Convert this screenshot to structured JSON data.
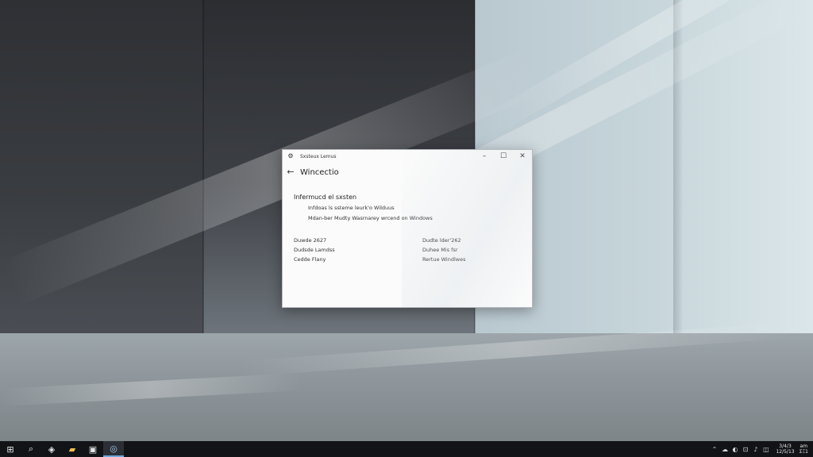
{
  "window": {
    "title": "Sxsteux Lemus",
    "page_title": "Wincectio",
    "section_heading": "Infermucd el sxsten",
    "details": [
      "Infdoas ls ssteme leurk'o Wilduus",
      "Mdan-ber Mudty Wasrnarey wrcend on Windows"
    ],
    "specs_left": [
      "Duwde 2627",
      "Dudsde Lamdss",
      "Cedde Flany"
    ],
    "specs_right": [
      "Dudte lder'262",
      "Duhee Mis fsr",
      "Rertue Windlwes"
    ]
  },
  "icons": {
    "app": "gear-icon",
    "back": "back-arrow-icon",
    "minimize": "minimize-icon",
    "maximize": "maximize-icon",
    "close": "close-icon"
  },
  "taskbar": {
    "items": [
      {
        "name": "start-button",
        "glyph": "⊞"
      },
      {
        "name": "search-button",
        "glyph": "⌕"
      },
      {
        "name": "task-view-button",
        "glyph": "◈"
      },
      {
        "name": "file-explorer-button",
        "glyph": "▰"
      },
      {
        "name": "store-button",
        "glyph": "▣"
      },
      {
        "name": "settings-app-button",
        "glyph": "◎"
      }
    ],
    "tray": [
      "⌃",
      "☁",
      "◐",
      "⊡",
      "♪",
      "◫"
    ],
    "clock_time": "3/4/3",
    "clock_date": "12/5/13",
    "clock_extra_top": "am",
    "clock_extra_bottom": "ΣΞ1"
  },
  "colors": {
    "taskbar": "#111316",
    "window_bg": "#fbfbfb",
    "accent": "#6fa8dc"
  }
}
